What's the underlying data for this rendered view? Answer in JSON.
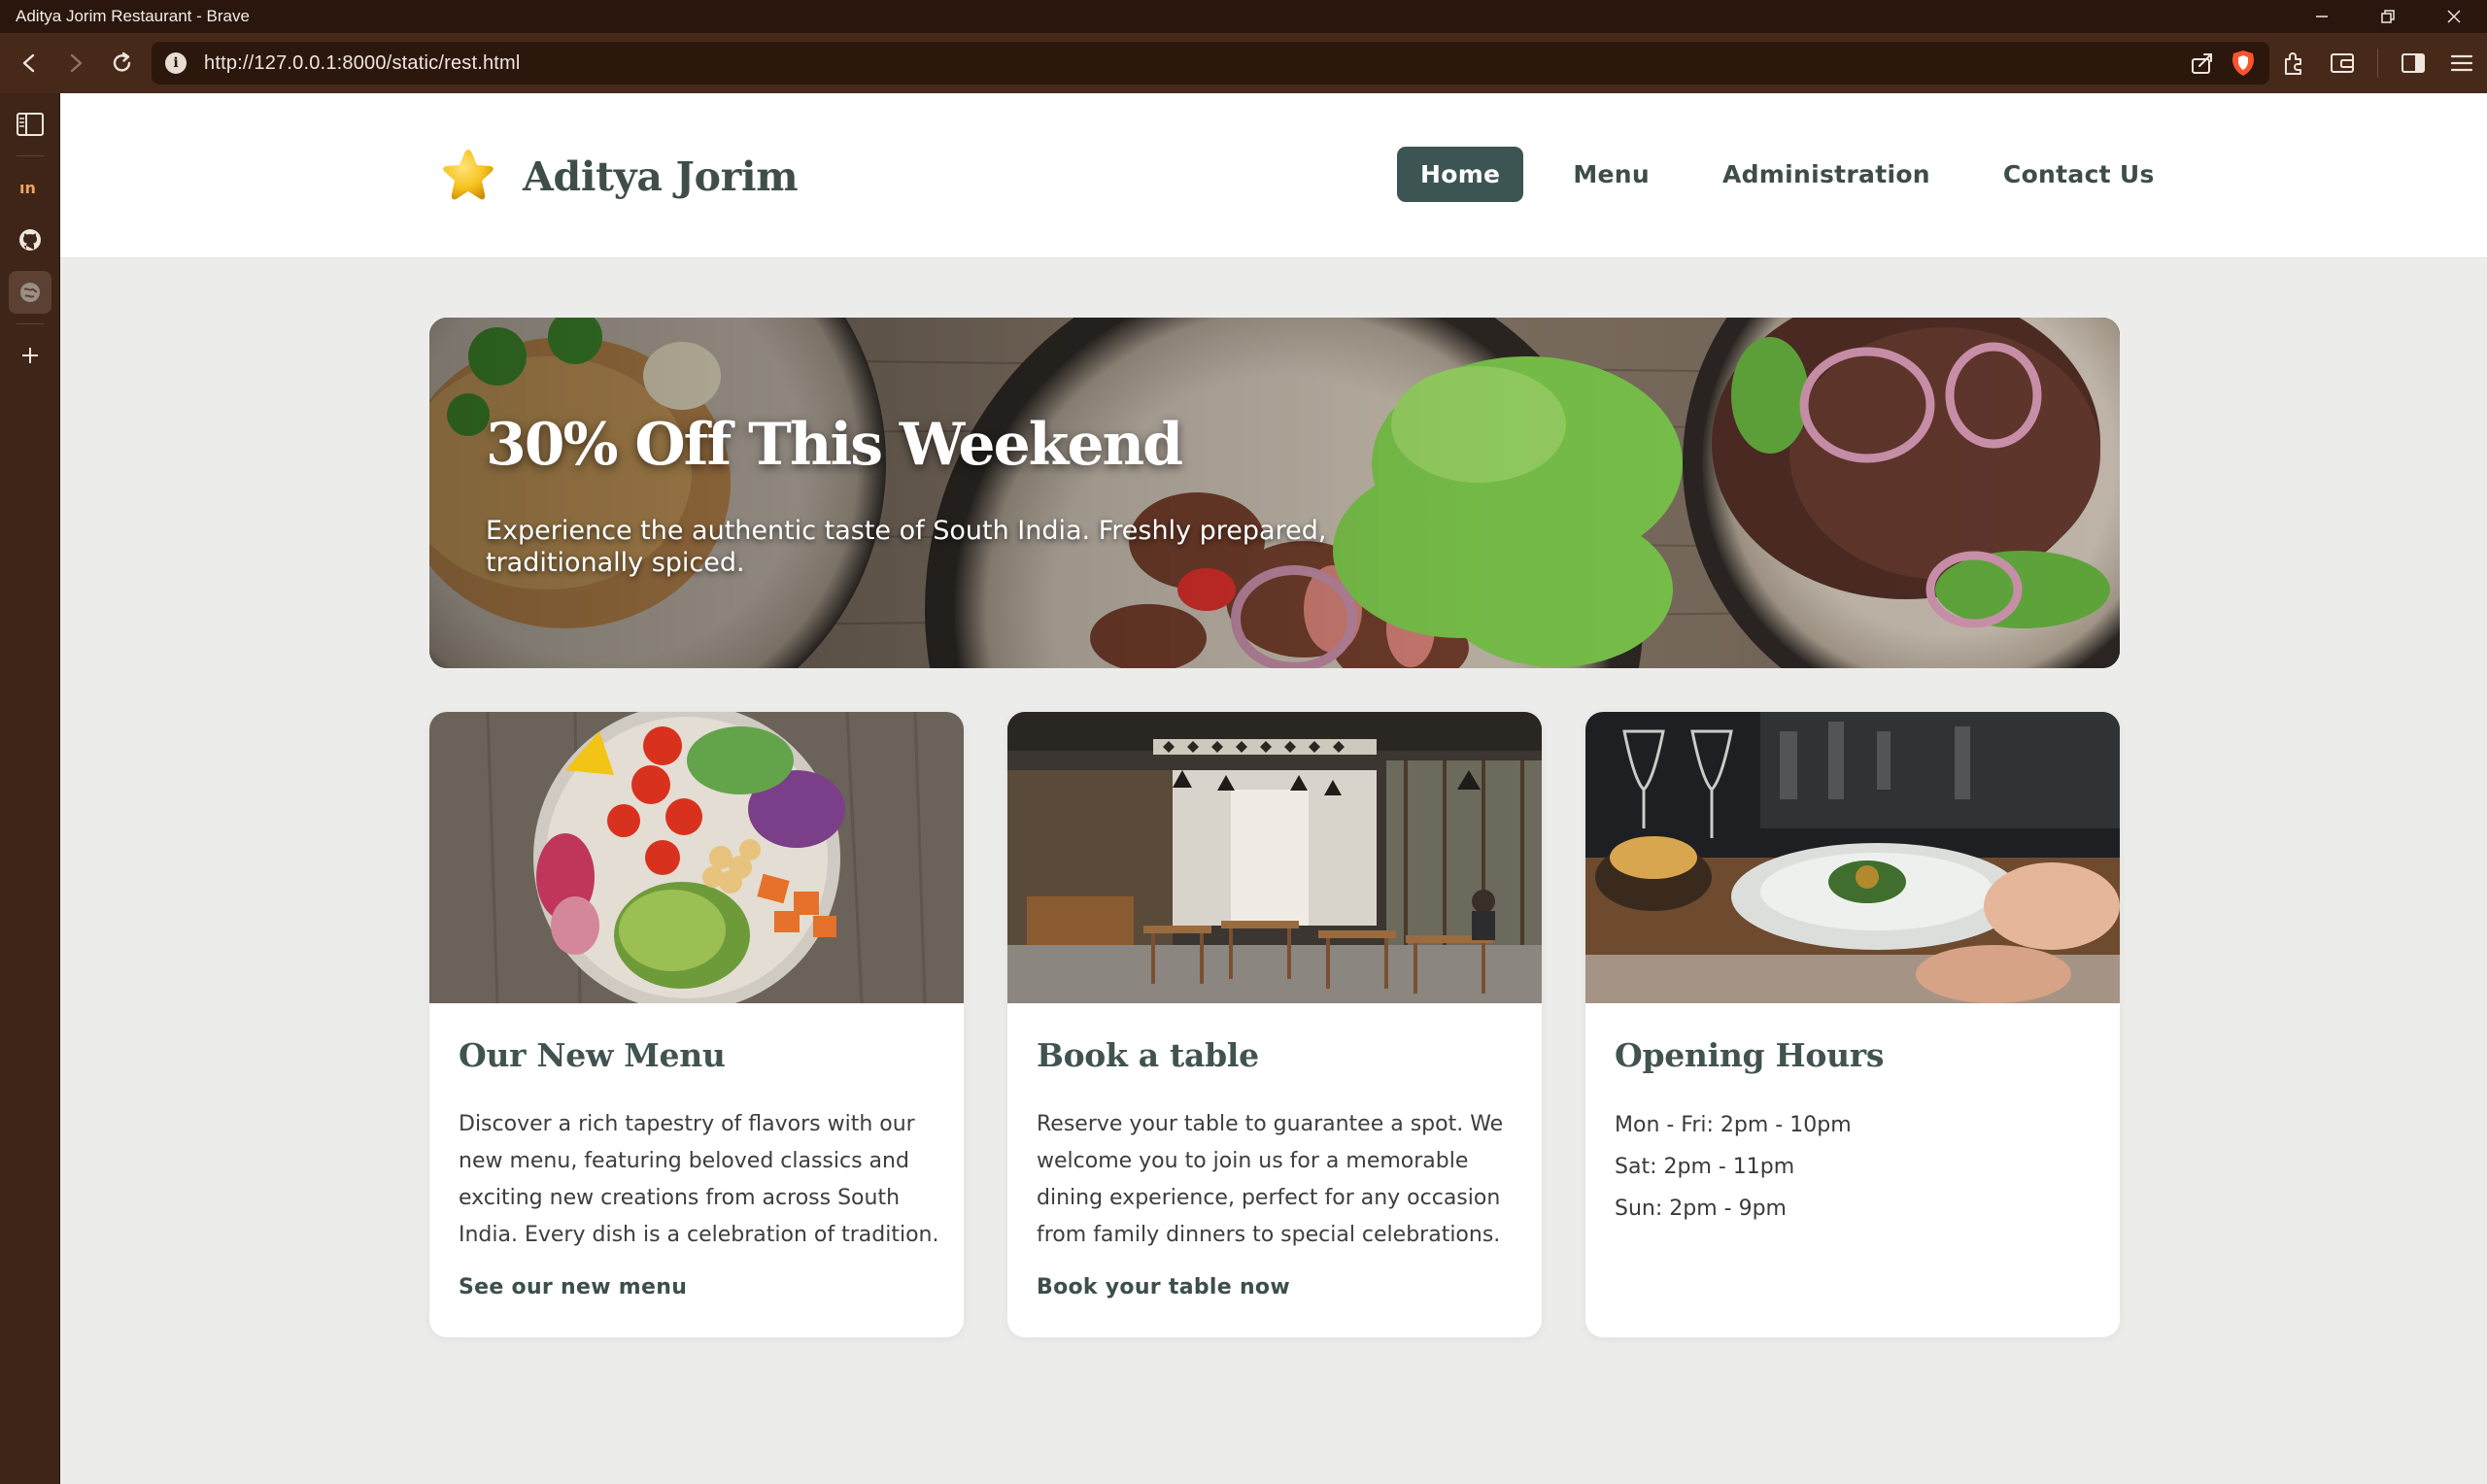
{
  "window": {
    "title": "Aditya Jorim Restaurant - Brave"
  },
  "browser": {
    "url": "http://127.0.0.1:8000/static/rest.html"
  },
  "site": {
    "brand": "Aditya Jorim",
    "nav": [
      {
        "label": "Home",
        "active": true
      },
      {
        "label": "Menu",
        "active": false
      },
      {
        "label": "Administration",
        "active": false
      },
      {
        "label": "Contact Us",
        "active": false
      }
    ],
    "accent_color": "#3d5552"
  },
  "hero": {
    "title": "30% Off This Weekend",
    "text": "Experience the authentic taste of South India. Freshly prepared, traditionally spiced."
  },
  "cards": [
    {
      "title": "Our New Menu",
      "text": "Discover a rich tapestry of flavors with our new menu, featuring beloved classics and exciting new creations from across South India. Every dish is a celebration of tradition.",
      "link": "See our new menu"
    },
    {
      "title": "Book a table",
      "text": "Reserve your table to guarantee a spot. We welcome you to join us for a memorable dining experience, perfect for any occasion from family dinners to special celebrations.",
      "link": "Book your table now"
    },
    {
      "title": "Opening Hours",
      "hours": [
        "Mon - Fri: 2pm - 10pm",
        "Sat: 2pm - 11pm",
        "Sun: 2pm - 9pm"
      ]
    }
  ]
}
